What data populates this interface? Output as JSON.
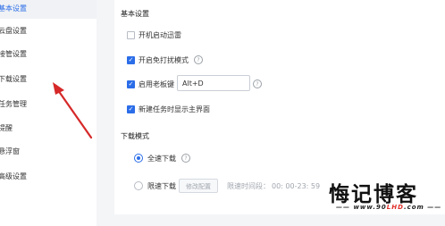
{
  "sidebar": {
    "items": [
      {
        "label": "基本设置",
        "active": true
      },
      {
        "label": "云盘设置"
      },
      {
        "label": "接管设置"
      },
      {
        "label": "下载设置"
      },
      {
        "label": "任务管理"
      },
      {
        "label": "提醒"
      },
      {
        "label": "悬浮窗"
      },
      {
        "label": "高级设置"
      }
    ]
  },
  "basic": {
    "title": "基本设置",
    "autostart": {
      "label": "开机启动迅雷",
      "checked": false
    },
    "dnd": {
      "label": "开启免打扰模式",
      "checked": true
    },
    "boss_key": {
      "label": "启用老板键",
      "checked": true,
      "value": "Alt+D"
    },
    "show_main": {
      "label": "新建任务时显示主界面",
      "checked": true
    }
  },
  "download_mode": {
    "title": "下载模式",
    "full_speed": {
      "label": "全速下载",
      "selected": true
    },
    "limited": {
      "label": "限速下载",
      "selected": false,
      "button": "修改配置",
      "time_label": "限速时间段：",
      "time_value": "00: 00-23: 59"
    }
  },
  "watermark": {
    "main": "悔记博客",
    "sub_black": "www.90",
    "sub_red": "LHD",
    "sub_tail": ".com"
  },
  "colors": {
    "accent": "#2b6de8",
    "arrow": "#d62828"
  },
  "icons": [
    "help-circle-icon",
    "checkmark-icon",
    "red-arrow-annotation"
  ]
}
